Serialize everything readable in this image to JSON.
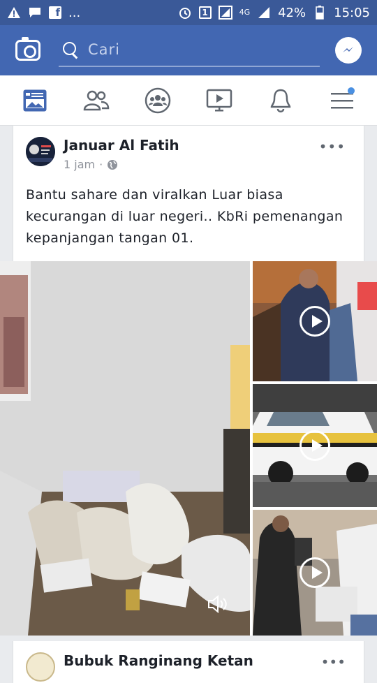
{
  "status_bar": {
    "overflow_indicator": "...",
    "signal_label": "4G",
    "sim_number": "1",
    "battery": "42%",
    "time": "15:05"
  },
  "top_bar": {
    "search_placeholder": "Cari"
  },
  "nav": {
    "items": [
      "news-feed",
      "friends",
      "groups",
      "watch",
      "notifications",
      "menu"
    ],
    "active": "news-feed",
    "accent": "#4267b2"
  },
  "post": {
    "author": "Januar Al Fatih",
    "time": "1 jam",
    "separator": "·",
    "text": "Bantu sahare dan viralkan Luar biasa kecurangan di luar negeri.. KbRi pemenangan kepanjangan tangan 01.",
    "more": "•••"
  },
  "next_post": {
    "author": "Bubuk Ranginang Ketan",
    "more": "•••"
  },
  "colors": {
    "brand": "#4267b2",
    "status": "#3a5998",
    "text": "#1d2129",
    "meta": "#90949c"
  }
}
